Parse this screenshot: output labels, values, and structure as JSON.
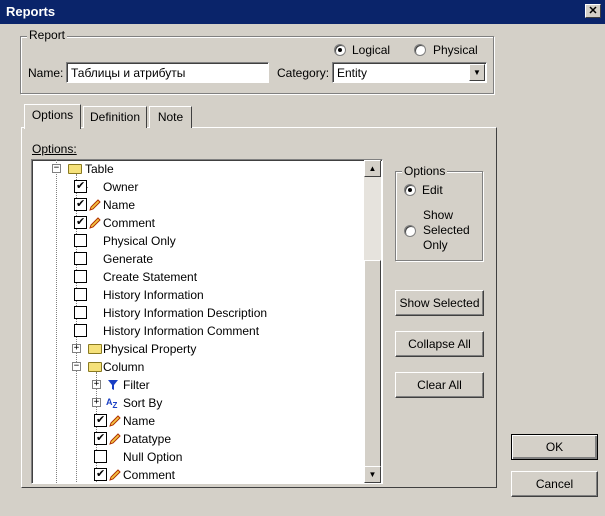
{
  "window": {
    "title": "Reports",
    "close_glyph": "✕"
  },
  "report_group": {
    "title": "Report",
    "mode_logical": "Logical",
    "mode_physical": "Physical",
    "selected_mode": "Logical",
    "name_label": "Name:",
    "name_value": "Таблицы и атрибуты",
    "category_label": "Category:",
    "category_value": "Entity"
  },
  "tabs": [
    {
      "label": "Options",
      "active": true
    },
    {
      "label": "Definition",
      "active": false
    },
    {
      "label": "Note",
      "active": false
    }
  ],
  "options_label": "Options:",
  "tree": [
    {
      "label": "Table",
      "checked": null,
      "expander": "−",
      "icon": "folder-icon"
    },
    {
      "label": "Owner",
      "checked": true,
      "icon": null
    },
    {
      "label": "Name",
      "checked": true,
      "icon": "pencil-icon"
    },
    {
      "label": "Comment",
      "checked": true,
      "icon": "pencil-icon"
    },
    {
      "label": "Physical Only",
      "checked": false,
      "icon": null
    },
    {
      "label": "Generate",
      "checked": false,
      "icon": null
    },
    {
      "label": "Create Statement",
      "checked": false,
      "icon": null
    },
    {
      "label": "History Information",
      "checked": false,
      "icon": null
    },
    {
      "label": "History Information Description",
      "checked": false,
      "icon": null
    },
    {
      "label": "History Information Comment",
      "checked": false,
      "icon": null
    },
    {
      "label": "Physical Property",
      "checked": null,
      "expander": "+",
      "icon": "folder-icon"
    },
    {
      "label": "Column",
      "checked": null,
      "expander": "−",
      "icon": "folder-icon"
    },
    {
      "label": "Filter",
      "checked": null,
      "expander": "+",
      "icon": "filter-icon"
    },
    {
      "label": "Sort By",
      "checked": null,
      "expander": "+",
      "icon": "sort-az-icon"
    },
    {
      "label": "Name",
      "checked": true,
      "icon": "pencil-icon"
    },
    {
      "label": "Datatype",
      "checked": true,
      "icon": "pencil-icon"
    },
    {
      "label": "Null Option",
      "checked": false,
      "icon": null
    },
    {
      "label": "Comment",
      "checked": true,
      "icon": "pencil-icon"
    }
  ],
  "options_group": {
    "title": "Options",
    "edit": "Edit",
    "show_selected_only_1": "Show",
    "show_selected_only_2": "Selected",
    "show_selected_only_3": "Only",
    "selected": "Edit"
  },
  "buttons": {
    "show_selected": "Show Selected",
    "collapse_all": "Collapse All",
    "clear_all": "Clear All",
    "ok": "OK",
    "cancel": "Cancel"
  }
}
